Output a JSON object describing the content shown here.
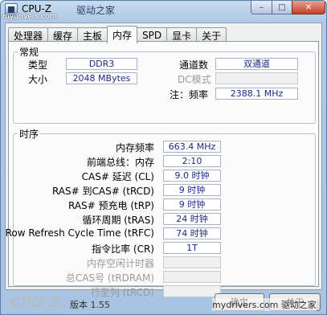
{
  "titlebar": {
    "title": "CPU-Z",
    "watermark": "mydrivers.com",
    "extra": "驱动之家",
    "min_icon": "minimize-icon",
    "max_icon": "maximize-icon",
    "close_icon": "close-icon",
    "min_glyph": "–",
    "max_glyph": "□",
    "close_glyph": "✕"
  },
  "tabs": [
    {
      "label": "处理器"
    },
    {
      "label": "缓存"
    },
    {
      "label": "主板"
    },
    {
      "label": "内存",
      "active": true
    },
    {
      "label": "SPD"
    },
    {
      "label": "显卡"
    },
    {
      "label": "关于"
    }
  ],
  "general": {
    "legend": "常规",
    "type_label": "类型",
    "type_value": "DDR3",
    "size_label": "大小",
    "size_value": "2048 MBytes",
    "channels_label": "通道数",
    "channels_value": "双通道",
    "dc_label": "DC模式",
    "dc_value": "",
    "note_label": "注：频率",
    "note_value": "2388.1 MHz"
  },
  "timings": {
    "legend": "时序",
    "rows": [
      {
        "label": "内存频率",
        "value": "663.4 MHz",
        "enabled": true
      },
      {
        "label": "前端总线：内存",
        "value": "2:10",
        "enabled": true
      },
      {
        "label": "CAS# 延迟 (CL)",
        "value": "9.0 时钟",
        "enabled": true
      },
      {
        "label": "RAS# 到CAS# (tRCD)",
        "value": "9 时钟",
        "enabled": true
      },
      {
        "label": "RAS# 预充电 (tRP)",
        "value": "9 时钟",
        "enabled": true
      },
      {
        "label": "循环周期 (tRAS)",
        "value": "24 时钟",
        "enabled": true
      },
      {
        "label": "Row Refresh Cycle Time (tRFC)",
        "value": "74 时钟",
        "enabled": true
      },
      {
        "label": "指令比率 (CR)",
        "value": "1T",
        "enabled": true
      },
      {
        "label": "内存空闲计时器",
        "value": "",
        "enabled": false
      },
      {
        "label": "总CAS号 (tRDRAM)",
        "value": "",
        "enabled": false
      },
      {
        "label": "行至列 (tRCD)",
        "value": "",
        "enabled": false
      }
    ]
  },
  "bottom": {
    "brand": "CPU-Z",
    "version": "版本 1.55",
    "ok_label": "确定",
    "about_label": "关于",
    "watermark": "mydrivers.com 驱动之家"
  }
}
